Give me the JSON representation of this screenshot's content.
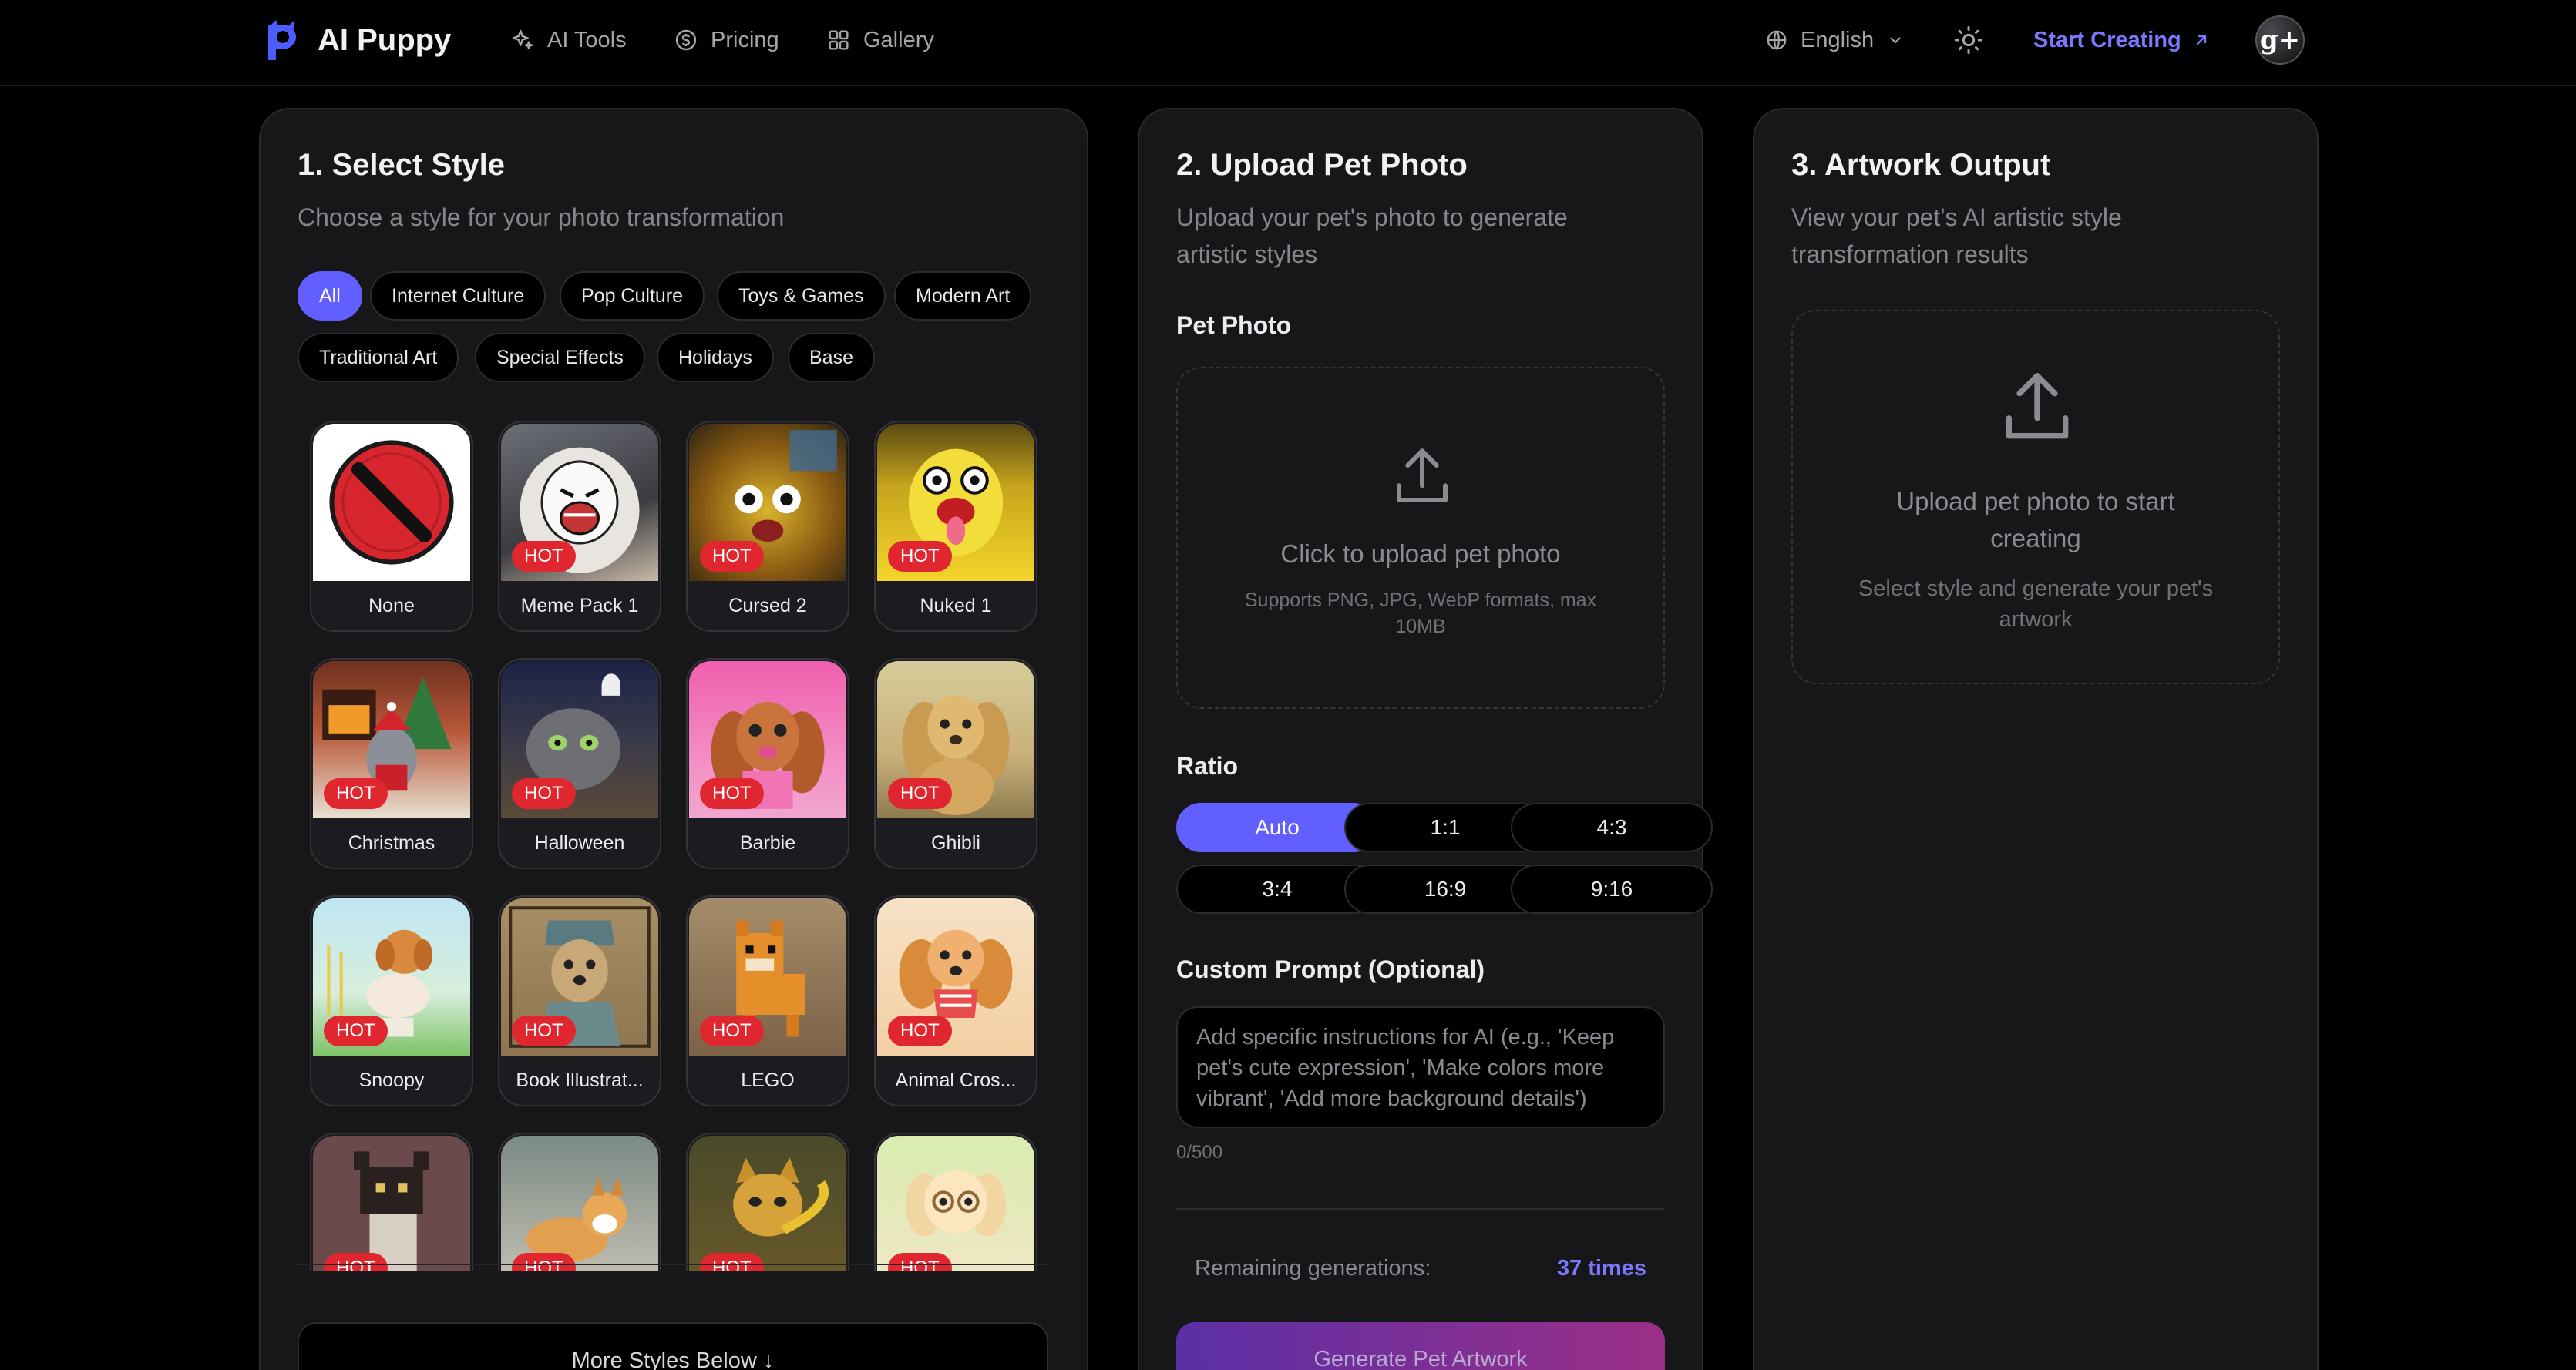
{
  "nav": {
    "brand": "AI Puppy",
    "links": [
      {
        "label": "AI Tools",
        "icon": "sparkles-icon"
      },
      {
        "label": "Pricing",
        "icon": "dollar-circle-icon"
      },
      {
        "label": "Gallery",
        "icon": "grid-icon"
      }
    ],
    "language": "English",
    "cta": "Start Creating",
    "avatar_letter": "g+"
  },
  "style_panel": {
    "title": "1. Select Style",
    "subtitle": "Choose a style for your photo transformation",
    "filters": [
      "All",
      "Internet Culture",
      "Pop Culture",
      "Toys & Games",
      "Modern Art",
      "Traditional Art",
      "Special Effects",
      "Holidays",
      "Base"
    ],
    "active_filter": "All",
    "hot_badge": "HOT",
    "styles": [
      {
        "name": "None",
        "hot": false
      },
      {
        "name": "Meme Pack 1",
        "hot": true
      },
      {
        "name": "Cursed 2",
        "hot": true
      },
      {
        "name": "Nuked 1",
        "hot": true
      },
      {
        "name": "Christmas",
        "hot": true
      },
      {
        "name": "Halloween",
        "hot": true
      },
      {
        "name": "Barbie",
        "hot": true
      },
      {
        "name": "Ghibli",
        "hot": true
      },
      {
        "name": "Snoopy",
        "hot": true
      },
      {
        "name": "Book Illustrat...",
        "hot": true
      },
      {
        "name": "LEGO",
        "hot": true
      },
      {
        "name": "Animal Cros...",
        "hot": true
      },
      {
        "name": "",
        "hot": true
      },
      {
        "name": "",
        "hot": true
      },
      {
        "name": "",
        "hot": true
      },
      {
        "name": "",
        "hot": true
      }
    ],
    "more_button": "More Styles Below ↓"
  },
  "upload_panel": {
    "title": "2. Upload Pet Photo",
    "subtitle_line1": "Upload your pet's photo to generate",
    "subtitle_line2": "artistic styles",
    "photo_label": "Pet Photo",
    "dropzone_title": "Click to upload pet photo",
    "dropzone_hint_line1": "Supports PNG, JPG, WebP formats, max",
    "dropzone_hint_line2": "10MB",
    "ratio_label": "Ratio",
    "ratios": [
      "Auto",
      "1:1",
      "4:3",
      "3:4",
      "16:9",
      "9:16"
    ],
    "active_ratio": "Auto",
    "prompt_label": "Custom Prompt (Optional)",
    "prompt_placeholder": "Add specific instructions for AI (e.g., 'Keep pet's cute expression', 'Make colors more vibrant', 'Add more background details')",
    "prompt_counter": "0/500",
    "remaining_label": "Remaining generations:",
    "remaining_value": "37 times",
    "generate_button": "Generate Pet Artwork"
  },
  "output_panel": {
    "title": "3. Artwork Output",
    "subtitle_line1": "View your pet's AI artistic style",
    "subtitle_line2": "transformation results",
    "empty_title_line1": "Upload pet photo to start",
    "empty_title_line2": "creating",
    "empty_hint_line1": "Select style and generate your pet's",
    "empty_hint_line2": "artwork"
  },
  "colors": {
    "accent": "#615fff",
    "hot": "#e0262f",
    "card_bg": "#17171a",
    "page_bg": "#000000"
  }
}
